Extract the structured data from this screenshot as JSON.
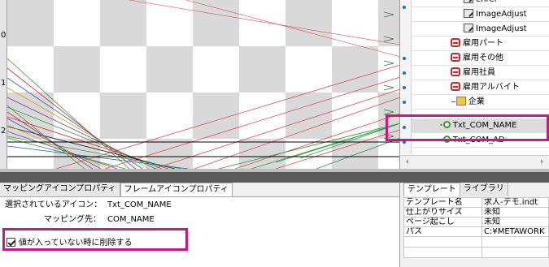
{
  "canvas": {
    "ruler_labels": [
      "0",
      "1",
      "2"
    ],
    "colors": {
      "checker": "#d9d9d9",
      "red_line": "#e05050",
      "green_line": "#3aa04a"
    }
  },
  "tree": {
    "items": [
      {
        "label": "enref",
        "icon": "image-icon"
      },
      {
        "label": "ImageAdjust",
        "icon": "image-icon"
      },
      {
        "label": "ImageAdjust",
        "icon": "image-icon"
      },
      {
        "label": "雇用パート",
        "icon": "red-minus-icon"
      },
      {
        "label": "雇用その他",
        "icon": "red-minus-icon"
      },
      {
        "label": "雇用社員",
        "icon": "red-minus-icon"
      },
      {
        "label": "雇用アルバイト",
        "icon": "red-minus-icon"
      },
      {
        "label": "企業",
        "icon": "folder-icon"
      },
      {
        "label": "Txt_COM_NAME",
        "icon": "green-circle-icon"
      },
      {
        "label": "Txt_COM_AD",
        "icon": "green-circle-icon"
      }
    ]
  },
  "props": {
    "tabs": [
      "マッピングアイコンプロパティ",
      "フレームアイコンプロパティ"
    ],
    "selected_icon_label": "選択されているアイコン：",
    "selected_icon_value": "Txt_COM_NAME",
    "mapping_dest_label": "マッピング先：",
    "mapping_dest_value": "COM_NAME",
    "delete_checkbox_label": "値が入っていない時に削除する",
    "delete_checked": true
  },
  "template": {
    "tabs": [
      "テンプレート",
      "ライブラリ"
    ],
    "header": [
      "テンプレート名",
      "求人-デモ.indt"
    ],
    "rows": [
      [
        "仕上がりサイズ",
        "未知"
      ],
      [
        "ページ起こし",
        "未知"
      ],
      [
        "パス",
        "C:¥METAWORK"
      ]
    ]
  },
  "accent": "#c4198a"
}
